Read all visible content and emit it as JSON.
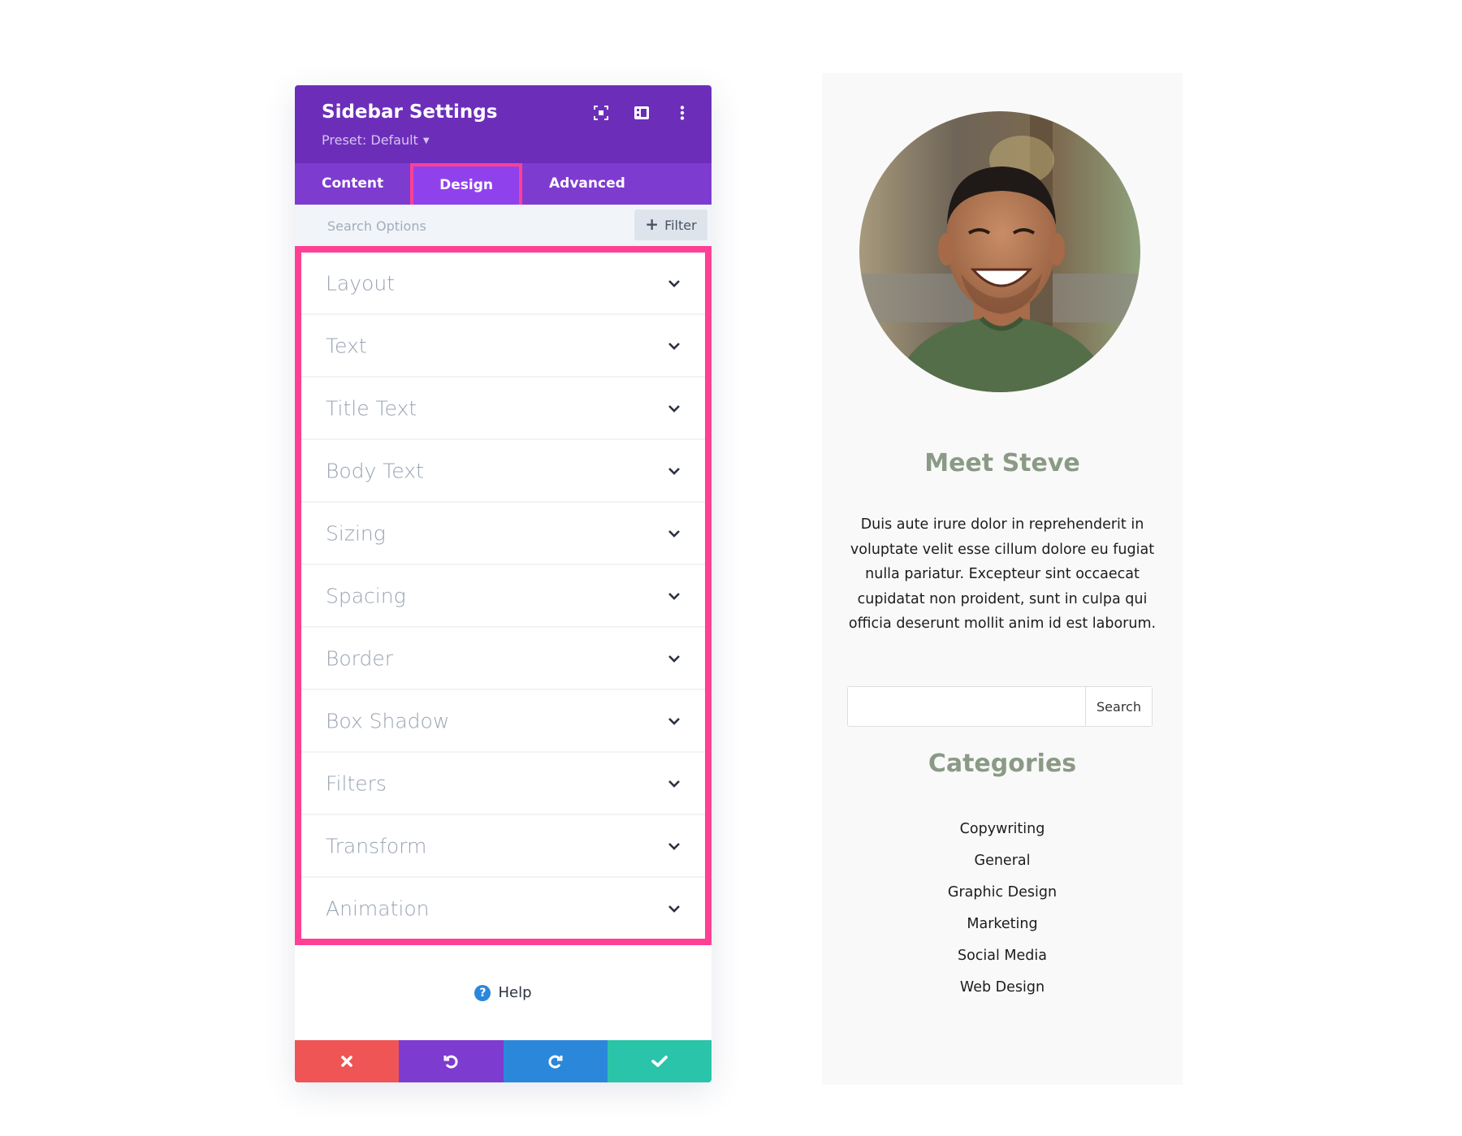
{
  "panel": {
    "title": "Sidebar Settings",
    "preset_label": "Preset: Default",
    "header_icons": [
      "focus-mode-icon",
      "split-view-icon",
      "more-options-icon"
    ],
    "tabs": [
      {
        "label": "Content",
        "active": false
      },
      {
        "label": "Design",
        "active": true
      },
      {
        "label": "Advanced",
        "active": false
      }
    ],
    "search": {
      "placeholder": "Search Options",
      "value": ""
    },
    "filter_label": "Filter",
    "option_groups": [
      {
        "label": "Layout"
      },
      {
        "label": "Text"
      },
      {
        "label": "Title Text"
      },
      {
        "label": "Body Text"
      },
      {
        "label": "Sizing"
      },
      {
        "label": "Spacing"
      },
      {
        "label": "Border"
      },
      {
        "label": "Box Shadow"
      },
      {
        "label": "Filters"
      },
      {
        "label": "Transform"
      },
      {
        "label": "Animation"
      }
    ],
    "help_label": "Help",
    "actions": [
      {
        "name": "discard",
        "icon": "close-icon",
        "color": "#ef5555"
      },
      {
        "name": "undo",
        "icon": "undo-icon",
        "color": "#7e3bd0"
      },
      {
        "name": "redo",
        "icon": "redo-icon",
        "color": "#2b87da"
      },
      {
        "name": "save",
        "icon": "check-icon",
        "color": "#29c4a9"
      }
    ],
    "colors": {
      "header": "#6c2eb9",
      "tabs": "#7e3bd0",
      "active_tab": "#8f42ec",
      "highlight": "#ff4094"
    }
  },
  "sidebar": {
    "heading": "Meet Steve",
    "bio": "Duis aute irure dolor in reprehenderit in voluptate velit esse cillum dolore eu fugiat nulla pariatur. Excepteur sint occaecat cupidatat non proident, sunt in culpa qui officia deserunt mollit anim id est laborum.",
    "search": {
      "value": "",
      "button_label": "Search"
    },
    "categories_title": "Categories",
    "categories": [
      "Copywriting",
      "General",
      "Graphic Design",
      "Marketing",
      "Social Media",
      "Web Design"
    ],
    "heading_color": "#8a9a86"
  }
}
